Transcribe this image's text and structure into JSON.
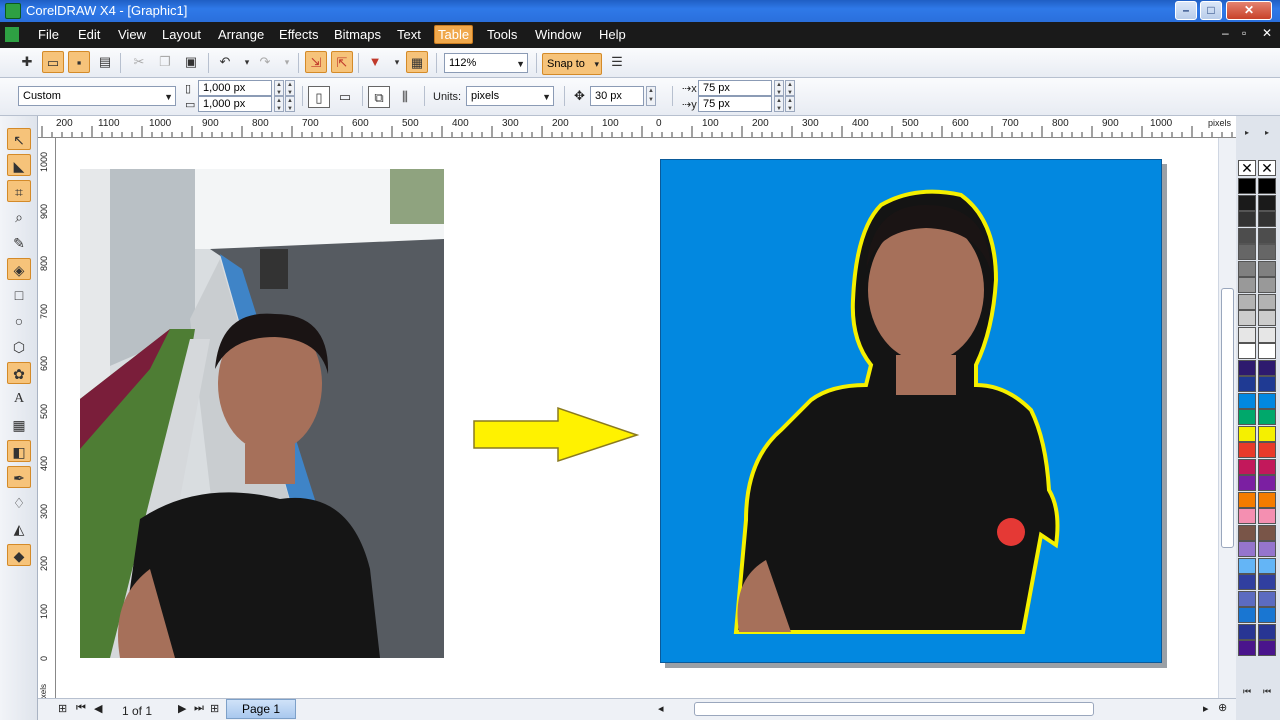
{
  "window": {
    "title": "CorelDRAW X4 - [Graphic1]"
  },
  "menu": [
    "File",
    "Edit",
    "View",
    "Layout",
    "Arrange",
    "Effects",
    "Bitmaps",
    "Text",
    "Table",
    "Tools",
    "Window",
    "Help"
  ],
  "menu_active": "Table",
  "toolbar": {
    "zoom": "112%",
    "snap": "Snap to"
  },
  "property_bar": {
    "page_preset": "Custom",
    "width": "1,000 px",
    "height": "1,000 px",
    "units_label": "Units:",
    "units": "pixels",
    "nudge": "30 px",
    "dup_x": "75 px",
    "dup_y": "75 px"
  },
  "ruler_top": [
    "200",
    "1100",
    "1000",
    "900",
    "800",
    "700",
    "600",
    "500",
    "400",
    "300",
    "200",
    "100",
    "0",
    "100",
    "200",
    "300",
    "400",
    "500",
    "600",
    "700",
    "800",
    "900",
    "1000",
    "pixels"
  ],
  "ruler_left": [
    "1000",
    "900",
    "800",
    "700",
    "600",
    "500",
    "400",
    "300",
    "200",
    "100",
    "0",
    "pixels"
  ],
  "status": {
    "page_count": "1 of 1",
    "page_tab": "Page 1"
  },
  "colors": {
    "accent": "#f6c37a",
    "canvas_blue": "#0288e0",
    "outline_yellow": "#f5f000",
    "arrow_yellow": "#fff200"
  },
  "palette": [
    "#000000",
    "#1a1a1a",
    "#333333",
    "#4d4d4d",
    "#666666",
    "#808080",
    "#999999",
    "#b3b3b3",
    "#cccccc",
    "#e6e6e6",
    "#ffffff",
    "#2e1a6e",
    "#1f3a93",
    "#0288e0",
    "#00a86b",
    "#f5f000",
    "#e83a2a",
    "#c2185b",
    "#7b1fa2",
    "#f57c00",
    "#f48fb1",
    "#795548",
    "#9575cd",
    "#64b5f6",
    "#303f9f",
    "#5c6bc0",
    "#1976d2",
    "#283593",
    "#4a148c"
  ]
}
